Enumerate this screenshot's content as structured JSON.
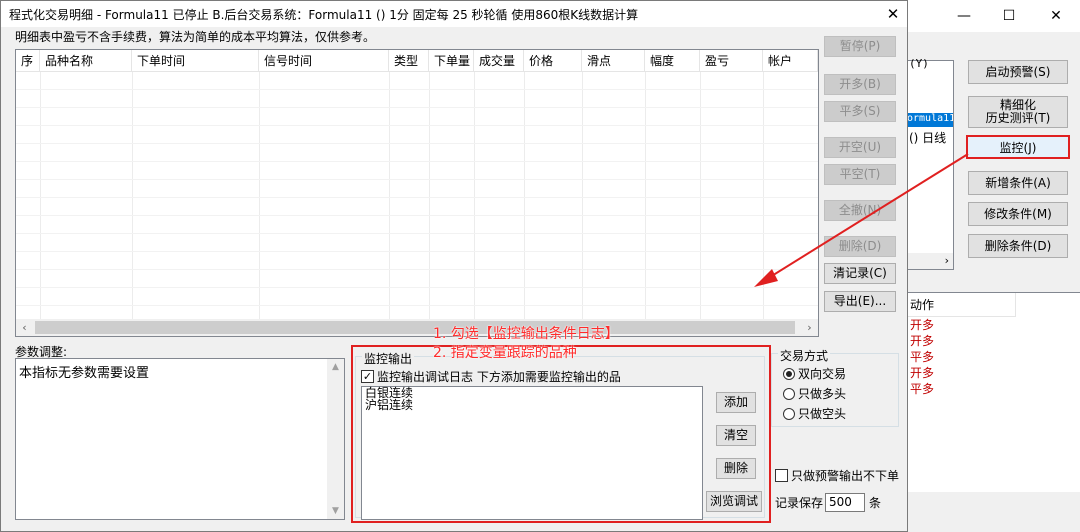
{
  "background_window": {
    "tab_text": "(Y)",
    "list_selected": "ormula11",
    "list_line2": "() 日线",
    "buttons": {
      "start_alert": "启动预警(S)",
      "refine_line1": "精细化",
      "refine_line2": "历史测评(T)",
      "monitor": "监控(J)",
      "add_condition": "新增条件(A)",
      "modify_condition": "修改条件(M)",
      "delete_condition": "删除条件(D)"
    },
    "action_header": "动作",
    "actions": [
      "开多",
      "开多",
      "平多",
      "开多",
      "平多"
    ]
  },
  "dialog": {
    "title": "程式化交易明细 - Formula11 已停止  B.后台交易系统：Formula11 () 1分 固定每 25 秒轮循 使用860根K线数据计算",
    "note": "明细表中盈亏不含手续费，算法为简单的成本平均算法，仅供参考。",
    "columns": [
      "序",
      "品种名称",
      "下单时间",
      "信号时间",
      "类型",
      "下单量",
      "成交量",
      "价格",
      "滑点",
      "幅度",
      "盈亏",
      "帐户"
    ],
    "side_buttons": {
      "pause": "暂停(P)",
      "open_long": "开多(B)",
      "close_long": "平多(S)",
      "open_short": "开空(U)",
      "close_short": "平空(T)",
      "cancel_all": "全撤(N)",
      "delete": "删除(D)",
      "clear_records": "清记录(C)",
      "export": "导出(E)..."
    },
    "param_label": "参数调整:",
    "param_text": "本指标无参数需要设置",
    "annotations": [
      "1. 勾选【监控输出条件日志】",
      "2. 指定变量跟踪的品种"
    ],
    "monitor": {
      "legend": "监控输出",
      "checkbox_label": "监控输出调试日志 下方添加需要监控输出的品",
      "checked": true,
      "items": [
        "白银连续",
        "沪铝连续"
      ],
      "buttons": {
        "add": "添加",
        "clear": "清空",
        "delete": "删除",
        "browse_debug": "浏览调试"
      }
    },
    "trade_mode": {
      "legend": "交易方式",
      "options": [
        "双向交易",
        "只做多头",
        "只做空头"
      ],
      "selected_index": 0
    },
    "alert_only_label": "只做预警输出不下单",
    "keep_records": {
      "prefix": "记录保存",
      "value": "500",
      "suffix": "条"
    }
  },
  "colors": {
    "annotation_red": "#ff2b2b",
    "highlight_border": "#e02020",
    "selection_blue": "#0078d7",
    "action_text": "#c00000"
  }
}
